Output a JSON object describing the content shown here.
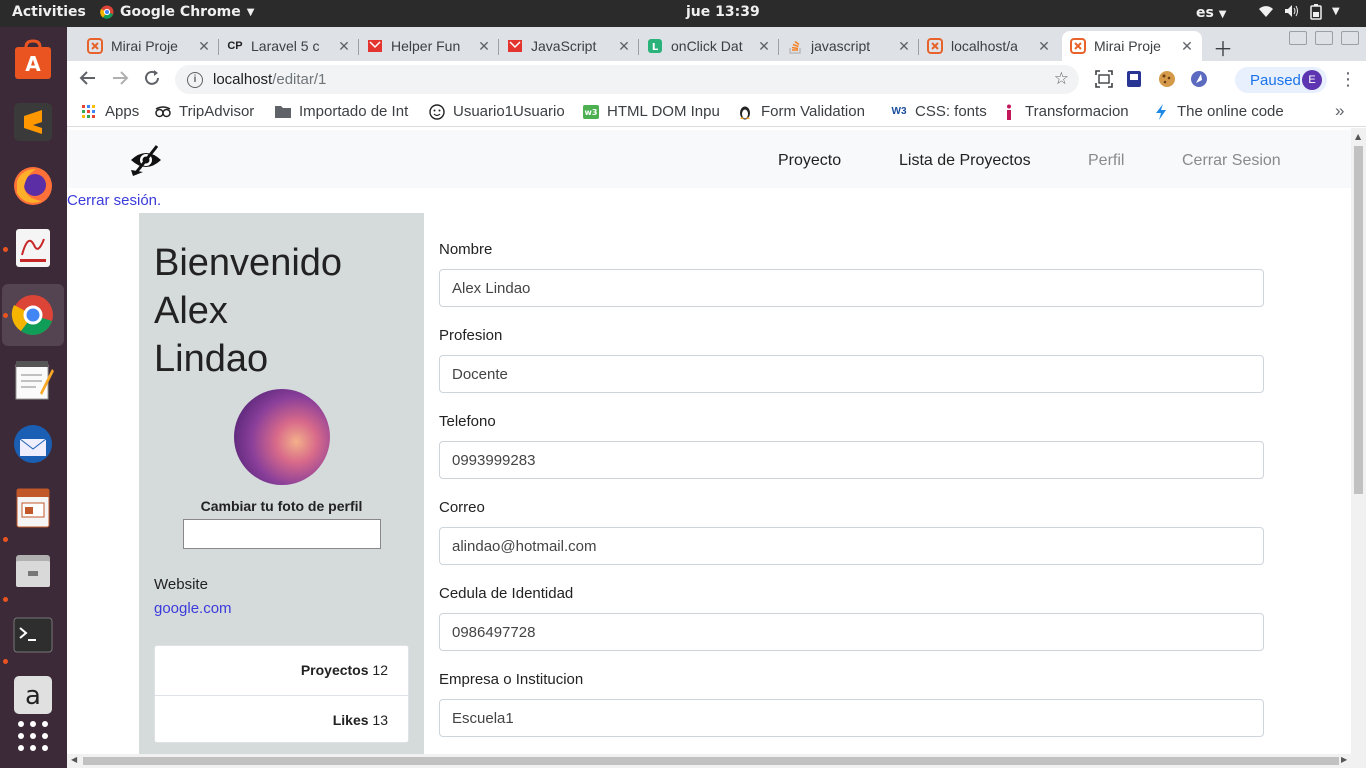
{
  "system": {
    "activities": "Activities",
    "app_name": "Google Chrome",
    "clock": "jue 13:39",
    "language": "es"
  },
  "tabs": [
    {
      "title": "Mirai Proje",
      "icon": "xampp-icon",
      "color": "#e8632b"
    },
    {
      "title": "Laravel 5 c",
      "icon": "cp-icon",
      "color": "#222222"
    },
    {
      "title": "Helper Fun",
      "icon": "laravel-icon",
      "color": "#e3342f"
    },
    {
      "title": "JavaScript",
      "icon": "laravel-icon",
      "color": "#e3342f"
    },
    {
      "title": "onClick Dat",
      "icon": "lumen-icon",
      "color": "#2ab27b"
    },
    {
      "title": "javascript",
      "icon": "stackoverflow-icon",
      "color": "#f48024"
    },
    {
      "title": "localhost/a",
      "icon": "xampp-icon",
      "color": "#e8632b"
    },
    {
      "title": "Mirai Proje",
      "icon": "xampp-icon",
      "color": "#e8632b"
    }
  ],
  "address": {
    "host": "localhost",
    "path": "/editar/1"
  },
  "profile_button": {
    "label": "Paused",
    "initial": "E"
  },
  "bookmarks": [
    {
      "label": "Apps",
      "icon": "apps-grid-icon"
    },
    {
      "label": "TripAdvisor",
      "icon": "tripadvisor-icon"
    },
    {
      "label": "Importado de Int",
      "icon": "folder-icon"
    },
    {
      "label": "Usuario1Usuario",
      "icon": "smiley-icon"
    },
    {
      "label": "HTML DOM Inpu",
      "icon": "w3schools-icon"
    },
    {
      "label": "Form Validation",
      "icon": "linux-icon"
    },
    {
      "label": "CSS: fonts",
      "icon": "w3c-icon"
    },
    {
      "label": "Transformacion",
      "icon": "info-icon"
    },
    {
      "label": "The online code",
      "icon": "bolt-icon"
    }
  ],
  "site_nav": {
    "items": [
      "Proyecto",
      "Lista de Proyectos",
      "Perfil",
      "Cerrar Sesion"
    ]
  },
  "logout_link": "Cerrar sesión.",
  "sidebar": {
    "welcome_lines": [
      "Bienvenido",
      "Alex",
      "Lindao"
    ],
    "photo_label": "Cambiar tu foto de perfil",
    "website_label": "Website",
    "website_value": "google.com",
    "stats": [
      {
        "label": "Proyectos",
        "value": "12"
      },
      {
        "label": "Likes",
        "value": "13"
      }
    ]
  },
  "form": {
    "fields": [
      {
        "label": "Nombre",
        "value": "Alex Lindao"
      },
      {
        "label": "Profesion",
        "value": "Docente"
      },
      {
        "label": "Telefono",
        "value": "0993999283"
      },
      {
        "label": "Correo",
        "value": "alindao@hotmail.com"
      },
      {
        "label": "Cedula de Identidad",
        "value": "0986497728"
      },
      {
        "label": "Empresa o Institucion",
        "value": "Escuela1"
      }
    ]
  }
}
